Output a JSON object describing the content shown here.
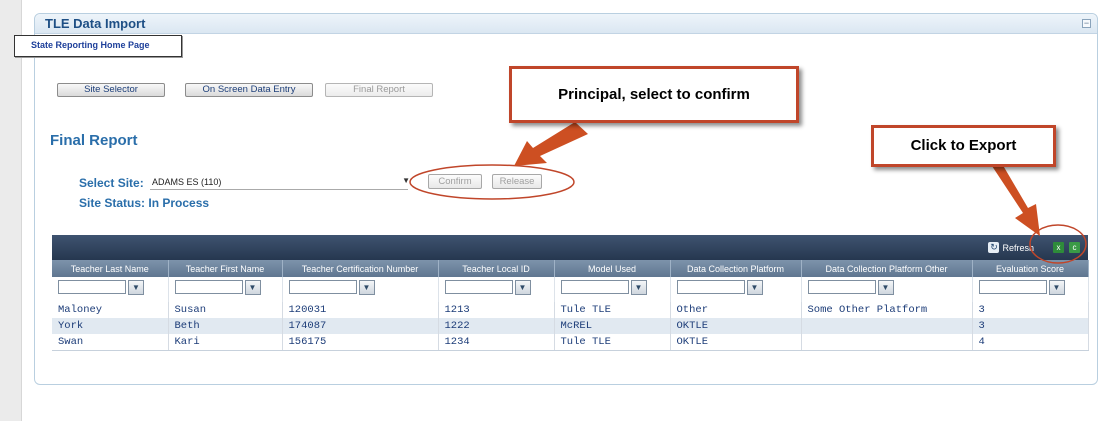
{
  "panel": {
    "title": "TLE Data Import",
    "collapse_symbol": "⊟"
  },
  "home_link": "State Reporting Home Page",
  "nav": {
    "site_selector": "Site Selector",
    "on_screen_data_entry": "On Screen Data Entry",
    "final_report": "Final Report"
  },
  "section_title": "Final Report",
  "site": {
    "select_label": "Select Site:",
    "selected_value": "ADAMS ES (110)",
    "status_label": "Site Status:",
    "status_value": "In Process"
  },
  "actions": {
    "confirm": "Confirm",
    "release": "Release"
  },
  "grid": {
    "refresh_label": "Refresh",
    "columns": [
      "Teacher Last Name",
      "Teacher First Name",
      "Teacher Certification Number",
      "Teacher Local ID",
      "Model Used",
      "Data Collection Platform",
      "Data Collection Platform Other",
      "Evaluation Score"
    ],
    "rows": [
      [
        "Maloney",
        "Susan",
        "120031",
        "1213",
        "Tule TLE",
        "Other",
        "Some Other Platform",
        "3"
      ],
      [
        "York",
        "Beth",
        "174087",
        "1222",
        "McREL",
        "OKTLE",
        "",
        "3"
      ],
      [
        "Swan",
        "Kari",
        "156175",
        "1234",
        "Tule TLE",
        "OKTLE",
        "",
        "4"
      ]
    ]
  },
  "annotations": {
    "principal": "Principal, select to confirm",
    "export": "Click to Export"
  },
  "colors": {
    "callout_border": "#c0462a",
    "arrow": "#cd4f22",
    "title_blue": "#2a6eaa",
    "grid_header": "#26374f"
  },
  "icons": {
    "refresh": "refresh-icon",
    "excel": "excel-export-icon",
    "csv": "csv-export-icon",
    "filter": "filter-icon"
  }
}
